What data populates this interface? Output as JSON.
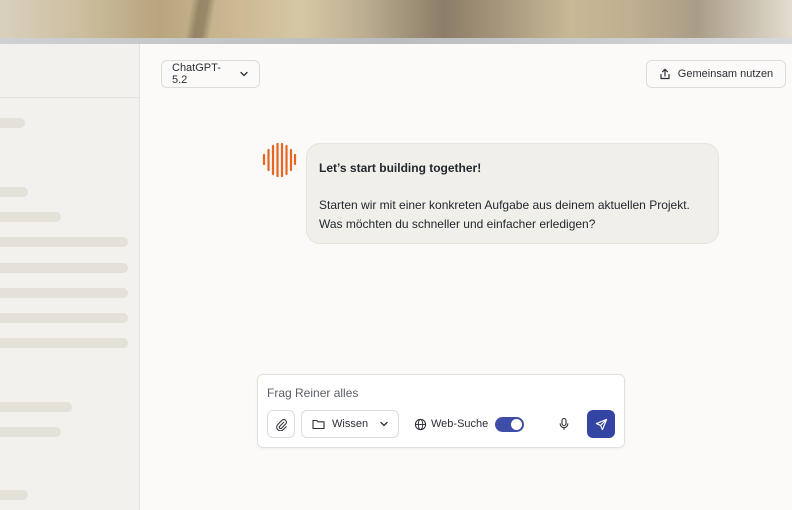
{
  "header": {
    "model_label": "ChatGPT-5.2",
    "share_label": "Gemeinsam nutzen"
  },
  "message": {
    "title": "Let’s start building together!",
    "line1": "Starten wir mit einer konkreten Aufgabe aus deinem aktuellen Projekt.",
    "line2": "Was möchten du schneller und einfacher erledigen?"
  },
  "composer": {
    "placeholder": "Frag Reiner alles",
    "knowledge_label": "Wissen",
    "web_search_label": "Web-Suche",
    "web_search_enabled": true
  },
  "icons": {
    "model_chevron": "chevron-down-icon",
    "share": "share-icon",
    "attach": "paperclip-icon",
    "folder": "folder-icon",
    "globe": "globe-icon",
    "mic": "microphone-icon",
    "send": "send-icon"
  },
  "colors": {
    "accent": "#3344a3",
    "logo": "#e8641f",
    "bubble": "#f0efea"
  }
}
